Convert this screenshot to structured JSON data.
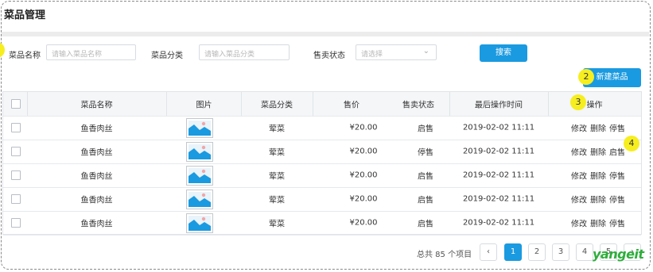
{
  "page": {
    "title": "菜品管理"
  },
  "markers": [
    "2",
    "3",
    "4"
  ],
  "filters": {
    "name_label": "菜品名称",
    "name_placeholder": "请输入菜品名称",
    "category_label": "菜品分类",
    "category_placeholder": "请输入菜品分类",
    "status_label": "售卖状态",
    "status_placeholder": "请选择",
    "search_button": "搜索"
  },
  "toolbar": {
    "new_button": "新建菜品"
  },
  "table": {
    "headers": [
      "菜品名称",
      "图片",
      "菜品分类",
      "售价",
      "售卖状态",
      "最后操作时间",
      "操作"
    ],
    "rows": [
      {
        "name": "鱼香肉丝",
        "category": "荤菜",
        "price": "¥20.00",
        "status": "启售",
        "time": "2019-02-02 11:11",
        "op_edit": "修改",
        "op_delete": "删除",
        "op_toggle": "停售"
      },
      {
        "name": "鱼香肉丝",
        "category": "荤菜",
        "price": "¥20.00",
        "status": "停售",
        "time": "2019-02-02 11:11",
        "op_edit": "修改",
        "op_delete": "删除",
        "op_toggle": "启售"
      },
      {
        "name": "鱼香肉丝",
        "category": "荤菜",
        "price": "¥20.00",
        "status": "启售",
        "time": "2019-02-02 11:11",
        "op_edit": "修改",
        "op_delete": "删除",
        "op_toggle": "停售"
      },
      {
        "name": "鱼香肉丝",
        "category": "荤菜",
        "price": "¥20.00",
        "status": "启售",
        "time": "2019-02-02 11:11",
        "op_edit": "修改",
        "op_delete": "删除",
        "op_toggle": "停售"
      },
      {
        "name": "鱼香肉丝",
        "category": "荤菜",
        "price": "¥20.00",
        "status": "启售",
        "time": "2019-02-02 11:11",
        "op_edit": "修改",
        "op_delete": "删除",
        "op_toggle": "停售"
      }
    ]
  },
  "pagination": {
    "total_text": "总共 85 个项目",
    "prev_icon": "chevron-left-icon",
    "pages": [
      "1",
      "2",
      "3",
      "4",
      "5"
    ],
    "active_page": "1",
    "next_icon": "chevron-right-icon"
  },
  "watermark": "yangeit",
  "colors": {
    "primary": "#1a9ae0",
    "marker": "#f6ee1f",
    "watermark": "#2eae3b"
  }
}
